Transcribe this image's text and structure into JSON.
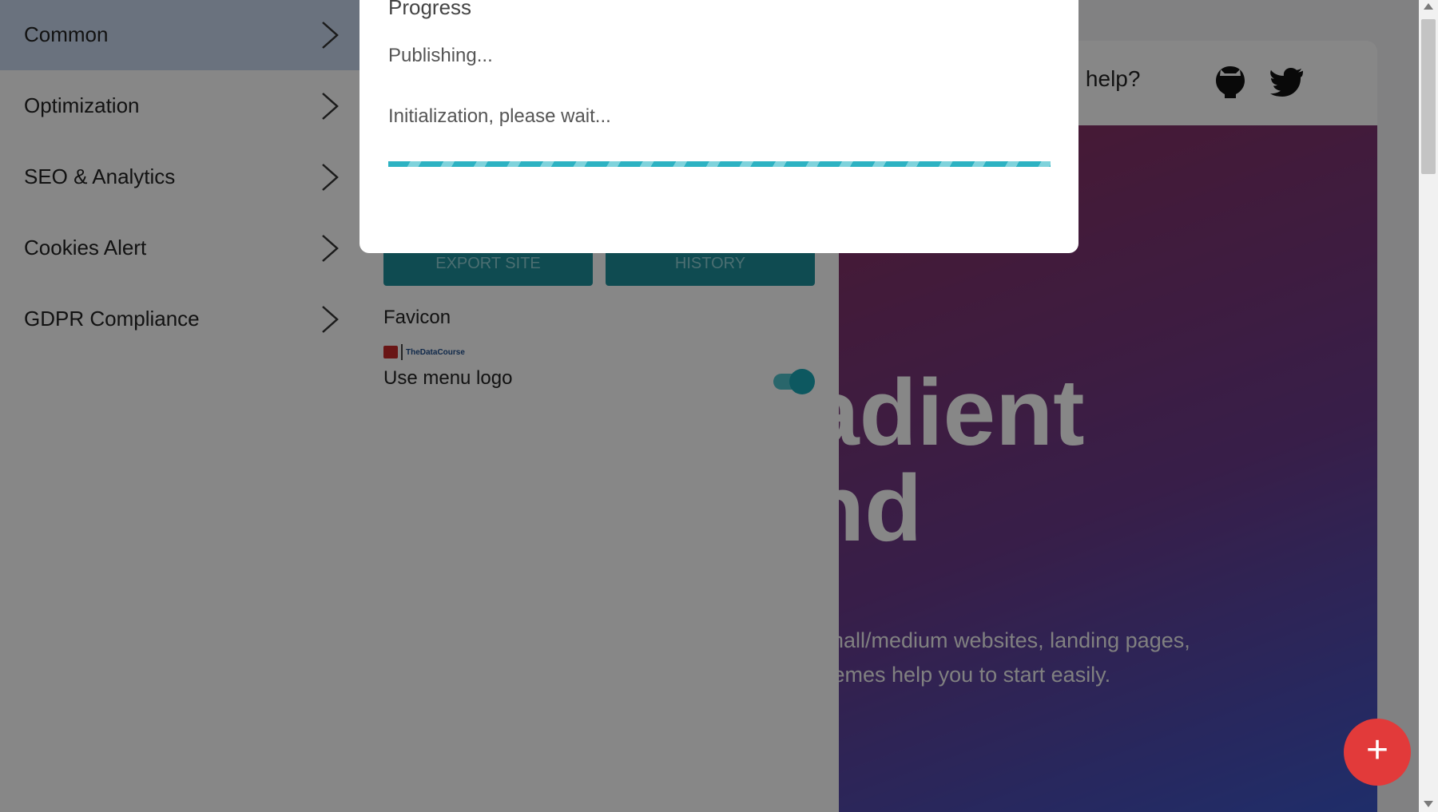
{
  "sidebar": {
    "items": [
      {
        "label": "Common",
        "active": true
      },
      {
        "label": "Optimization",
        "active": false
      },
      {
        "label": "SEO & Analytics",
        "active": false
      },
      {
        "label": "Cookies Alert",
        "active": false
      },
      {
        "label": "GDPR Compliance",
        "active": false
      }
    ]
  },
  "editor": {
    "export_label": "EXPORT SITE",
    "history_label": "HISTORY",
    "favicon_label": "Favicon",
    "favicon_text": "TheDataCourse",
    "menu_logo_label": "Use menu logo",
    "menu_logo_enabled": true
  },
  "preview": {
    "need_help": "ed help?",
    "hero_line1": "adient",
    "hero_line2": "nd",
    "hero_sub_line1": "small/medium websites, landing pages,",
    "hero_sub_line2": "themes help you to start easily.",
    "icons": [
      "github-icon",
      "twitter-icon"
    ]
  },
  "modal": {
    "title": "Progress",
    "status": "Publishing...",
    "message": "Initialization, please wait...",
    "progress_percent": 100
  },
  "fab": {
    "label": "+"
  },
  "colors": {
    "accent": "#2db2c2",
    "fab": "#e23a3a",
    "sidebar_active": "#c9d8ee",
    "button": "#1d8f99"
  }
}
